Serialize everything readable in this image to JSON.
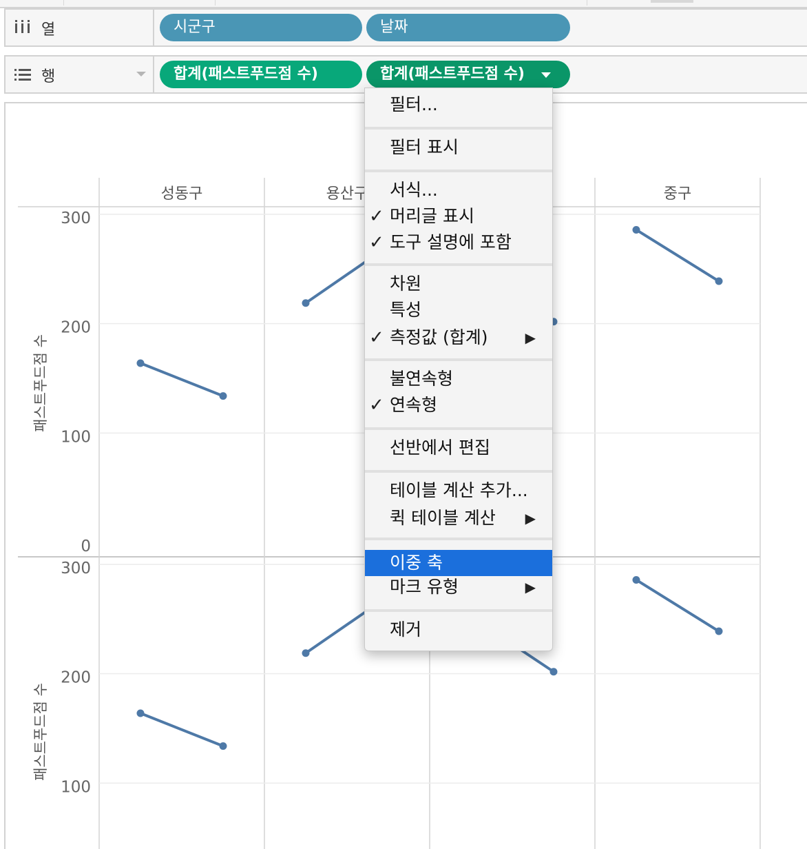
{
  "columns_shelf": {
    "label": "열",
    "icon": "columns-icon",
    "pills": [
      {
        "label": "시군구",
        "color": "#4a96b5"
      },
      {
        "label": "날짜",
        "color": "#4a96b5"
      }
    ]
  },
  "rows_shelf": {
    "label": "행",
    "icon": "rows-icon",
    "pills": [
      {
        "label": "합계(패스트푸드점 수)",
        "color": "#08a87a"
      },
      {
        "label": "합계(패스트푸드점 수)",
        "color": "#0a9668"
      }
    ]
  },
  "context_menu": {
    "items": [
      {
        "label": "필터...",
        "checked": false,
        "submenu": false
      },
      {
        "label": "필터 표시",
        "checked": false,
        "submenu": false
      },
      {
        "label": "서식...",
        "checked": false,
        "submenu": false
      },
      {
        "label": "머리글 표시",
        "checked": true,
        "submenu": false
      },
      {
        "label": "도구 설명에 포함",
        "checked": true,
        "submenu": false
      },
      {
        "label": "차원",
        "checked": false,
        "submenu": false
      },
      {
        "label": "특성",
        "checked": false,
        "submenu": false
      },
      {
        "label": "측정값 (합계)",
        "checked": true,
        "submenu": true
      },
      {
        "label": "불연속형",
        "checked": false,
        "submenu": false
      },
      {
        "label": "연속형",
        "checked": true,
        "submenu": false
      },
      {
        "label": "선반에서 편집",
        "checked": false,
        "submenu": false
      },
      {
        "label": "테이블 계산 추가...",
        "checked": false,
        "submenu": false
      },
      {
        "label": "퀵 테이블 계산",
        "checked": false,
        "submenu": true
      },
      {
        "label": "이중 축",
        "checked": false,
        "submenu": false,
        "highlighted": true
      },
      {
        "label": "마크 유형",
        "checked": false,
        "submenu": true
      },
      {
        "label": "제거",
        "checked": false,
        "submenu": false
      }
    ],
    "check_glyph": "✓",
    "submenu_glyph": "▶"
  },
  "chart_data": {
    "type": "line",
    "column_headers": [
      "성동구",
      "용산구",
      "중구"
    ],
    "y_axis_label": "패스트푸드점 수",
    "top_pane": {
      "yticks": [
        "300",
        "200",
        "100",
        "0"
      ],
      "ylim": [
        0,
        300
      ]
    },
    "bottom_pane": {
      "yticks": [
        "300",
        "200",
        "100"
      ],
      "ylim": [
        0,
        300
      ]
    },
    "series": [
      {
        "district": "성동구",
        "values": [
          167,
          137
        ]
      },
      {
        "district": "용산구",
        "values": [
          222,
          null
        ]
      },
      {
        "district": "중구",
        "values": [
          null,
          205
        ]
      },
      {
        "district": "중구",
        "values": [
          289,
          242
        ]
      }
    ],
    "line_color": "#4e79a7",
    "grid": true
  }
}
